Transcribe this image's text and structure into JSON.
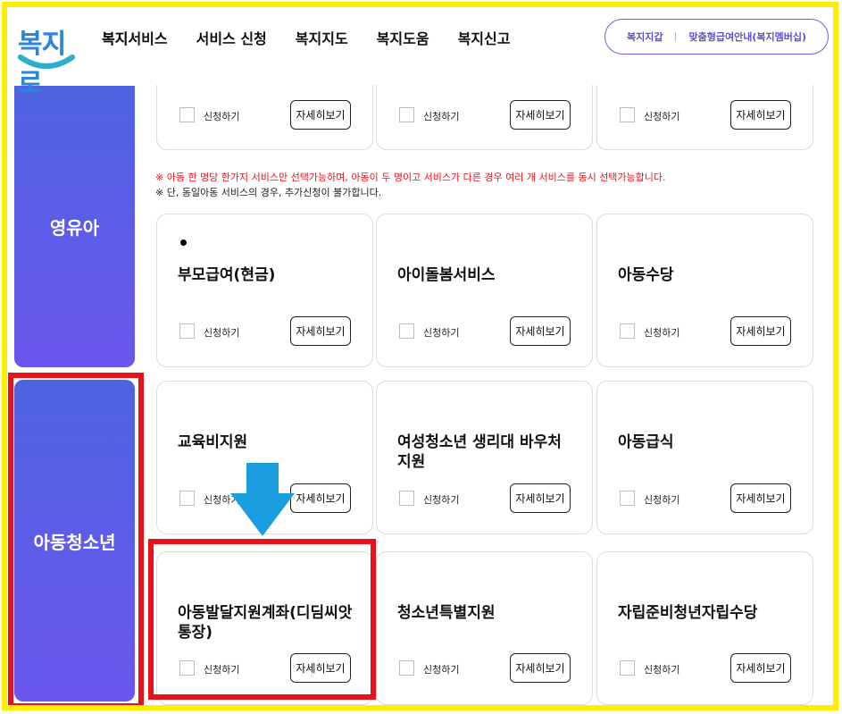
{
  "header": {
    "logo_text": "복지로",
    "nav": [
      "복지서비스",
      "서비스 신청",
      "복지지도",
      "복지도움",
      "복지신고"
    ],
    "pill": [
      "복지지갑",
      "맞춤형급여안내(복지멤버십)"
    ]
  },
  "sidebar": {
    "tabs": [
      {
        "label": "영유아"
      },
      {
        "label": "아동청소년"
      }
    ]
  },
  "common": {
    "apply_label": "신청하기",
    "detail_label": "자세히보기"
  },
  "notice": {
    "line1": "※ 아동 한 명당 한가지 서비스만 선택가능하며, 아동이 두 명이고 서비스가 다른 경우 여러 개 서비스를 동시 선택가능합니다.",
    "line2": "※ 단, 동일아동 서비스의 경우, 추가신청이 불가합니다."
  },
  "cards": {
    "top_partial": [
      "",
      "",
      ""
    ],
    "row1": [
      "부모급여(현금)",
      "아이돌봄서비스",
      "아동수당"
    ],
    "row2": [
      "교육비지원",
      "여성청소년 생리대 바우처 지원",
      "아동급식"
    ],
    "row3": [
      "아동발달지원계좌(디딤씨앗 통장)",
      "청소년특별지원",
      "자립준비청년자립수당"
    ]
  },
  "colors": {
    "brand": "#2d86d9",
    "tab_gradient_top": "#4e63e0",
    "tab_gradient_bottom": "#6b57ee",
    "highlight_red": "#e8121b",
    "highlight_yellow": "#ffee00",
    "arrow_blue": "#1a9ee0"
  }
}
